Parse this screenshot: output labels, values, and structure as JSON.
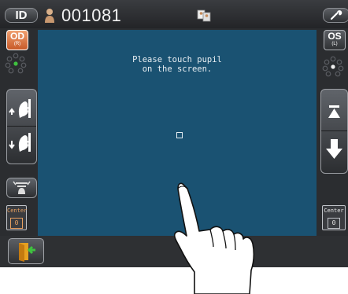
{
  "header": {
    "id_button_label": "ID",
    "patient_id": "001081"
  },
  "eye_buttons": {
    "od_label": "OD",
    "od_sub": "(R)",
    "os_label": "OS",
    "os_sub": "(L)"
  },
  "viewport": {
    "instruction": "Please touch pupil\non the screen."
  },
  "center_left": {
    "label": "Center",
    "value": "0"
  },
  "center_right": {
    "label": "Center",
    "value": "0"
  },
  "colors": {
    "viewport_bg": "#1a5272",
    "od_accent": "#e07a40",
    "indicator_green": "#3fc23f"
  },
  "icons": {
    "person": "person-icon",
    "compare": "compare-photo-icon",
    "wrench": "wrench-icon",
    "face_up": "chin-up-icon",
    "face_down": "chin-down-icon",
    "chinrest": "chinrest-icon",
    "arrow_up": "arrow-up-icon",
    "arrow_down": "arrow-down-icon",
    "exit": "exit-door-icon",
    "hand": "touch-hand-icon"
  }
}
